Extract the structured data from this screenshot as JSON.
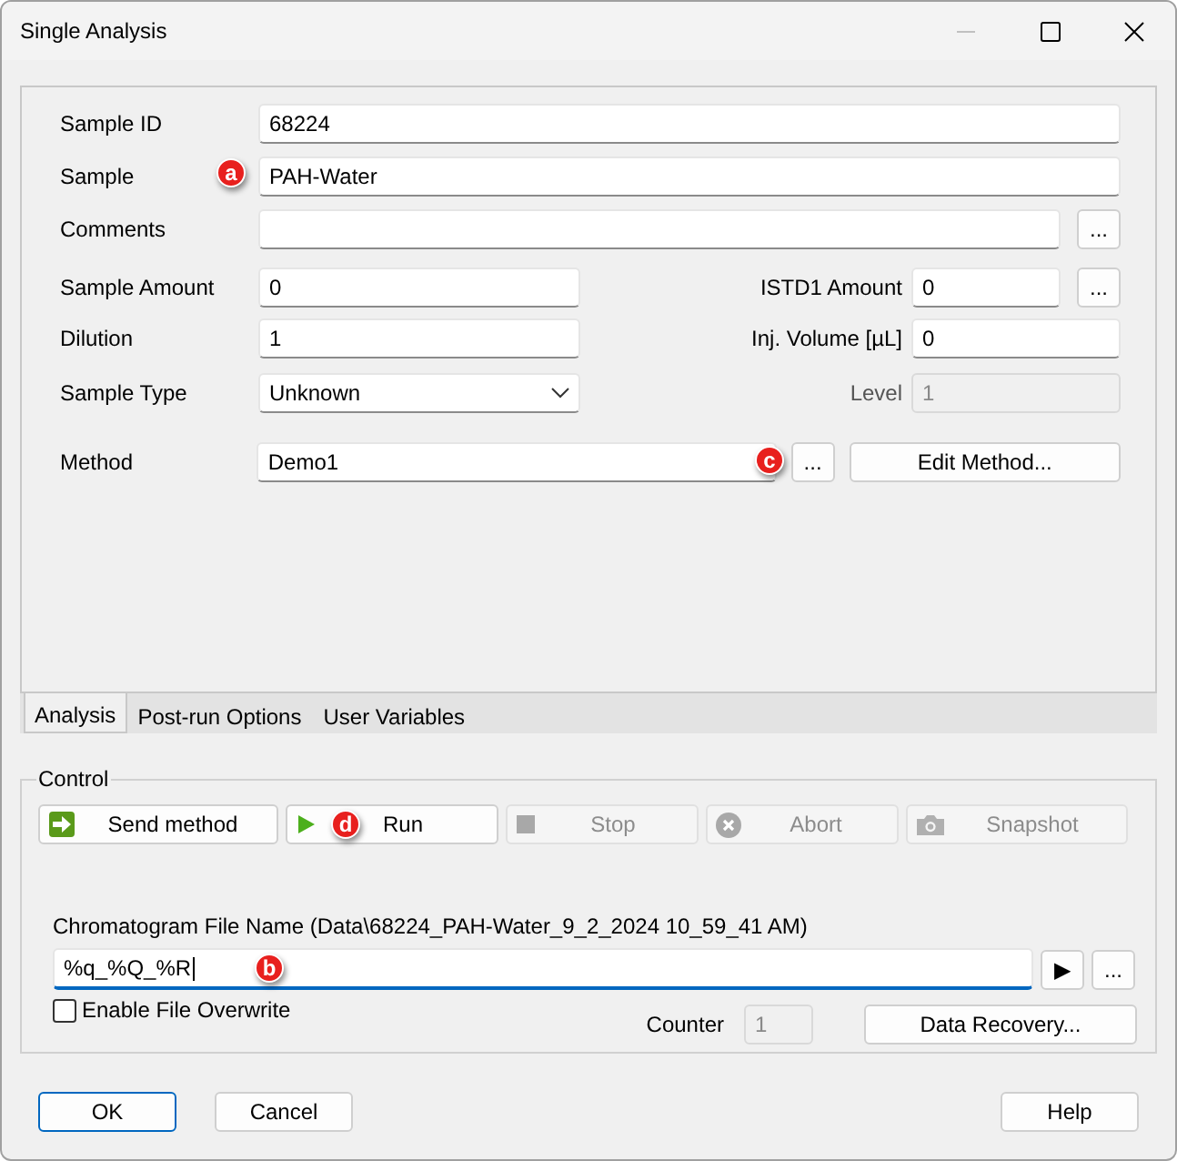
{
  "window": {
    "title": "Single Analysis"
  },
  "form": {
    "sample_id": {
      "label": "Sample ID",
      "value": "68224"
    },
    "sample": {
      "label": "Sample",
      "value": "PAH-Water",
      "callout": "a"
    },
    "comments": {
      "label": "Comments",
      "browse": "..."
    },
    "sample_amount": {
      "label": "Sample Amount",
      "value": "0"
    },
    "istd1_amount": {
      "label": "ISTD1 Amount",
      "value": "0",
      "browse": "..."
    },
    "dilution": {
      "label": "Dilution",
      "value": "1"
    },
    "inj_volume": {
      "label": "Inj. Volume [µL]",
      "value": "0"
    },
    "sample_type": {
      "label": "Sample Type",
      "value": "Unknown"
    },
    "level": {
      "label": "Level",
      "value": "1",
      "disabled": true
    },
    "method": {
      "label": "Method",
      "value": "Demo1",
      "callout": "c",
      "browse": "...",
      "edit_button": "Edit Method..."
    }
  },
  "tabs": [
    {
      "label": "Analysis",
      "selected": true
    },
    {
      "label": "Post-run Options",
      "selected": false
    },
    {
      "label": "User Variables",
      "selected": false
    }
  ],
  "control": {
    "title": "Control",
    "buttons": [
      {
        "kind": "send",
        "label": "Send method",
        "disabled": false
      },
      {
        "kind": "run",
        "label": "Run",
        "disabled": false,
        "callout": "d"
      },
      {
        "kind": "stop",
        "label": "Stop",
        "disabled": true
      },
      {
        "kind": "abort",
        "label": "Abort",
        "disabled": true
      },
      {
        "kind": "snapshot",
        "label": "Snapshot",
        "disabled": true
      }
    ],
    "file_name": {
      "label": "Chromatogram File Name (Data\\68224_PAH-Water_9_2_2024 10_59_41 AM)",
      "value": "%q_%Q_%R",
      "callout": "b",
      "preview": "▶",
      "browse": "..."
    },
    "overwrite": {
      "label": "Enable File Overwrite",
      "checked": false
    },
    "counter": {
      "label": "Counter",
      "value": "1",
      "disabled": true
    },
    "recovery_button": "Data Recovery..."
  },
  "footer": {
    "ok": "OK",
    "cancel": "Cancel",
    "help": "Help"
  }
}
